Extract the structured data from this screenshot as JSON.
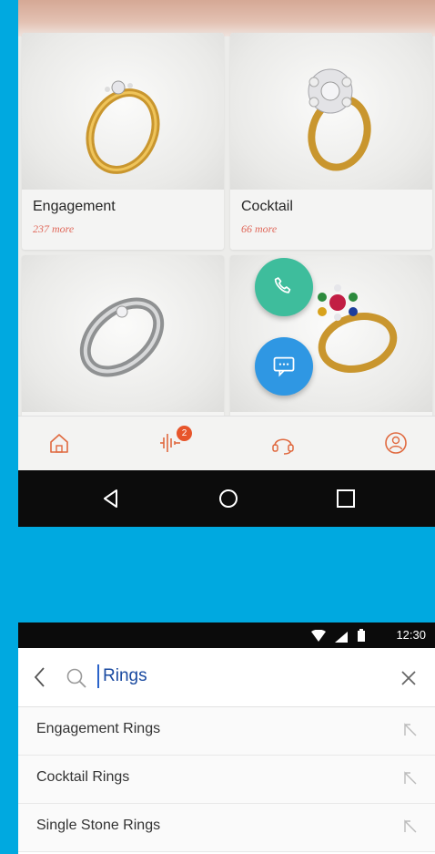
{
  "categories": [
    {
      "title": "Engagement",
      "more": "237 more"
    },
    {
      "title": "Cocktail",
      "more": "66 more"
    },
    {
      "title": "",
      "more": ""
    },
    {
      "title": "",
      "more": ""
    }
  ],
  "bottom_nav": {
    "items": [
      "home-icon",
      "equalizer-icon",
      "headset-icon",
      "profile-icon"
    ],
    "badge": "2"
  },
  "fabs": [
    "phone-icon",
    "chat-icon"
  ],
  "system_nav": [
    "back-icon",
    "home-circle-icon",
    "recents-icon"
  ],
  "status": {
    "time": "12:30"
  },
  "search": {
    "query": "Rings",
    "suggestions": [
      "Engagement Rings",
      "Cocktail Rings",
      "Single Stone Rings"
    ]
  },
  "colors": {
    "accent": "#00a9e0",
    "phone_fab": "#3ebd9c",
    "chat_fab": "#2f97e3",
    "badge": "#e7552b",
    "more_text": "#e0685a"
  }
}
